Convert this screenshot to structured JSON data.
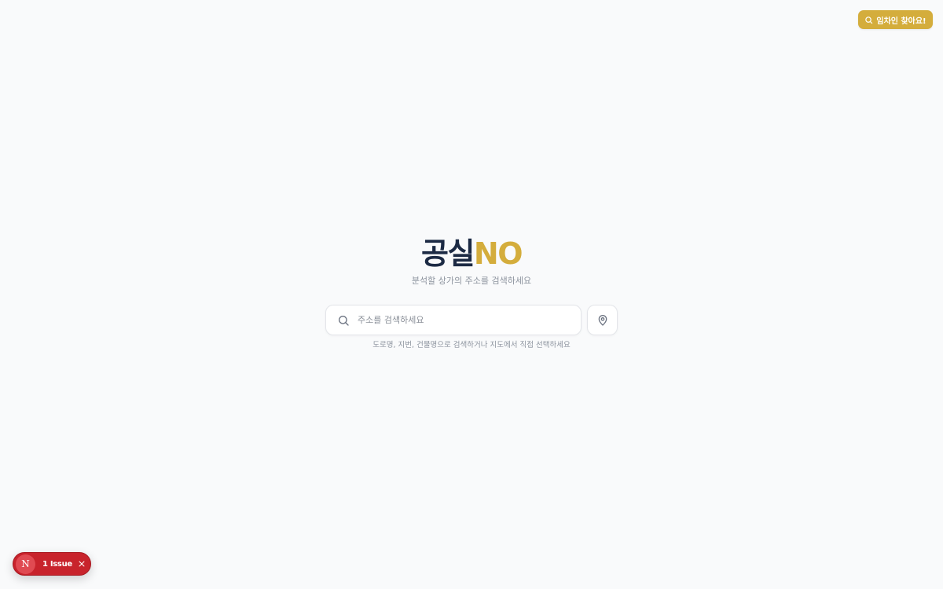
{
  "header": {
    "tenant_button_label": "임차인 찾아요!",
    "tenant_button_icon": "search-icon"
  },
  "brand": {
    "name_main": "공실",
    "name_accent": "NO",
    "main_color": "#1c2a44",
    "accent_color": "#d4ad3c"
  },
  "hero": {
    "subtitle": "분석할 상가의 주소를 검색하세요"
  },
  "search": {
    "placeholder": "주소를 검색하세요",
    "value": "",
    "icon": "search-icon",
    "map_button_icon": "map-pin-icon",
    "hint": "도로명, 지번, 건물명으로 검색하거나 지도에서 직접 선택하세요"
  },
  "dev_overlay": {
    "logo_letter": "N",
    "issues_label": "1 Issue",
    "close_icon": "close-icon",
    "color": "#c8232c"
  }
}
